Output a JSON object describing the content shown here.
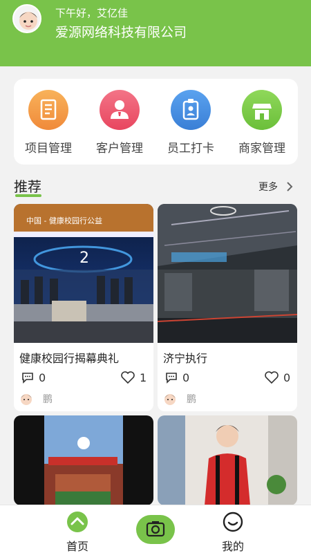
{
  "header": {
    "greeting": "下午好，艾亿佳",
    "company": "爱源网络科技有限公司"
  },
  "quick_actions": [
    {
      "label": "项目管理",
      "icon": "document-icon",
      "color": "#f5a24a"
    },
    {
      "label": "客户管理",
      "icon": "person-icon",
      "color": "#ee5a71"
    },
    {
      "label": "员工打卡",
      "icon": "badge-icon",
      "color": "#4a90e2"
    },
    {
      "label": "商家管理",
      "icon": "store-icon",
      "color": "#7ccb46"
    }
  ],
  "recommend": {
    "title": "推荐",
    "more": "更多"
  },
  "cards": [
    {
      "title": "健康校园行揭幕典礼",
      "comments": "0",
      "likes": "1",
      "author": "鹏",
      "image_banner": "中国 - 健康校园行公益"
    },
    {
      "title": "济宁执行",
      "comments": "0",
      "likes": "0",
      "author": "鹏"
    },
    {
      "title": "",
      "comments": "",
      "likes": "",
      "author": ""
    },
    {
      "title": "",
      "comments": "",
      "likes": "",
      "author": ""
    }
  ],
  "bottom_nav": {
    "home": "首页",
    "mine": "我的"
  },
  "colors": {
    "brand_green": "#79c34a",
    "background": "#f2f2f2"
  }
}
